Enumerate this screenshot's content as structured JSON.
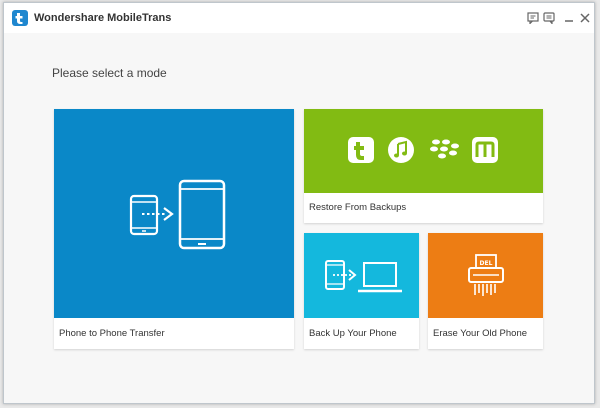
{
  "window": {
    "title": "Wondershare MobileTrans",
    "icons": {
      "logo": "mobiletrans-logo-icon",
      "feedback": "feedback-icon",
      "chat": "chat-icon",
      "minimize": "minimize-icon",
      "close": "close-icon"
    }
  },
  "main": {
    "prompt": "Please select a mode"
  },
  "modes": {
    "phone_transfer": {
      "label": "Phone to Phone Transfer",
      "color": "#0a88c8",
      "icon": "phone-to-phone-icon"
    },
    "restore": {
      "label": "Restore From Backups",
      "color": "#82bb13",
      "icons": [
        "mobiletrans-backup-icon",
        "itunes-icon",
        "blackberry-icon",
        "kies-icon"
      ]
    },
    "backup": {
      "label": "Back Up Your Phone",
      "color": "#14b8dd",
      "icon": "phone-to-computer-icon"
    },
    "erase": {
      "label": "Erase Your Old Phone",
      "color": "#ed7d14",
      "icon": "shredder-icon"
    }
  }
}
